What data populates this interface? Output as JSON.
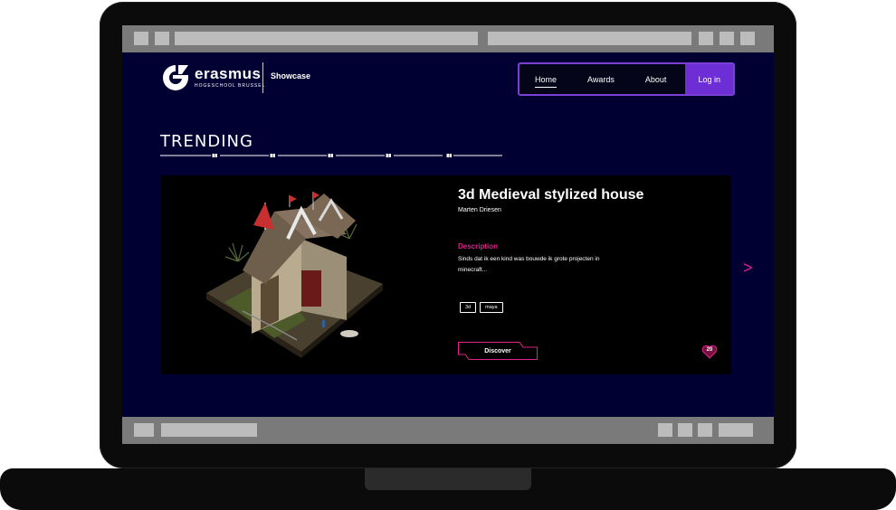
{
  "brand": {
    "word": "erasmus",
    "sub": "HOGESCHOOL BRUSSEL",
    "section": "Showcase"
  },
  "nav": {
    "items": [
      {
        "label": "Home",
        "active": true
      },
      {
        "label": "Awards",
        "active": false
      },
      {
        "label": "About",
        "active": false
      }
    ],
    "login_label": "Log in"
  },
  "section_title": "TRENDING",
  "card": {
    "title": "3d Medieval stylized house",
    "author": "Marten Driesen",
    "description_label": "Description",
    "description": "Sinds dat ik een kind was bouwde ik grote projecten in minecraft...",
    "tags": [
      "3d",
      "maya"
    ],
    "discover_label": "Discover",
    "likes": "20"
  },
  "colors": {
    "background": "#000033",
    "accent_pink": "#e0218a",
    "accent_purple": "#6e2ed6"
  },
  "icons": {
    "next": "chevron-right-icon",
    "likes": "heart-icon"
  }
}
